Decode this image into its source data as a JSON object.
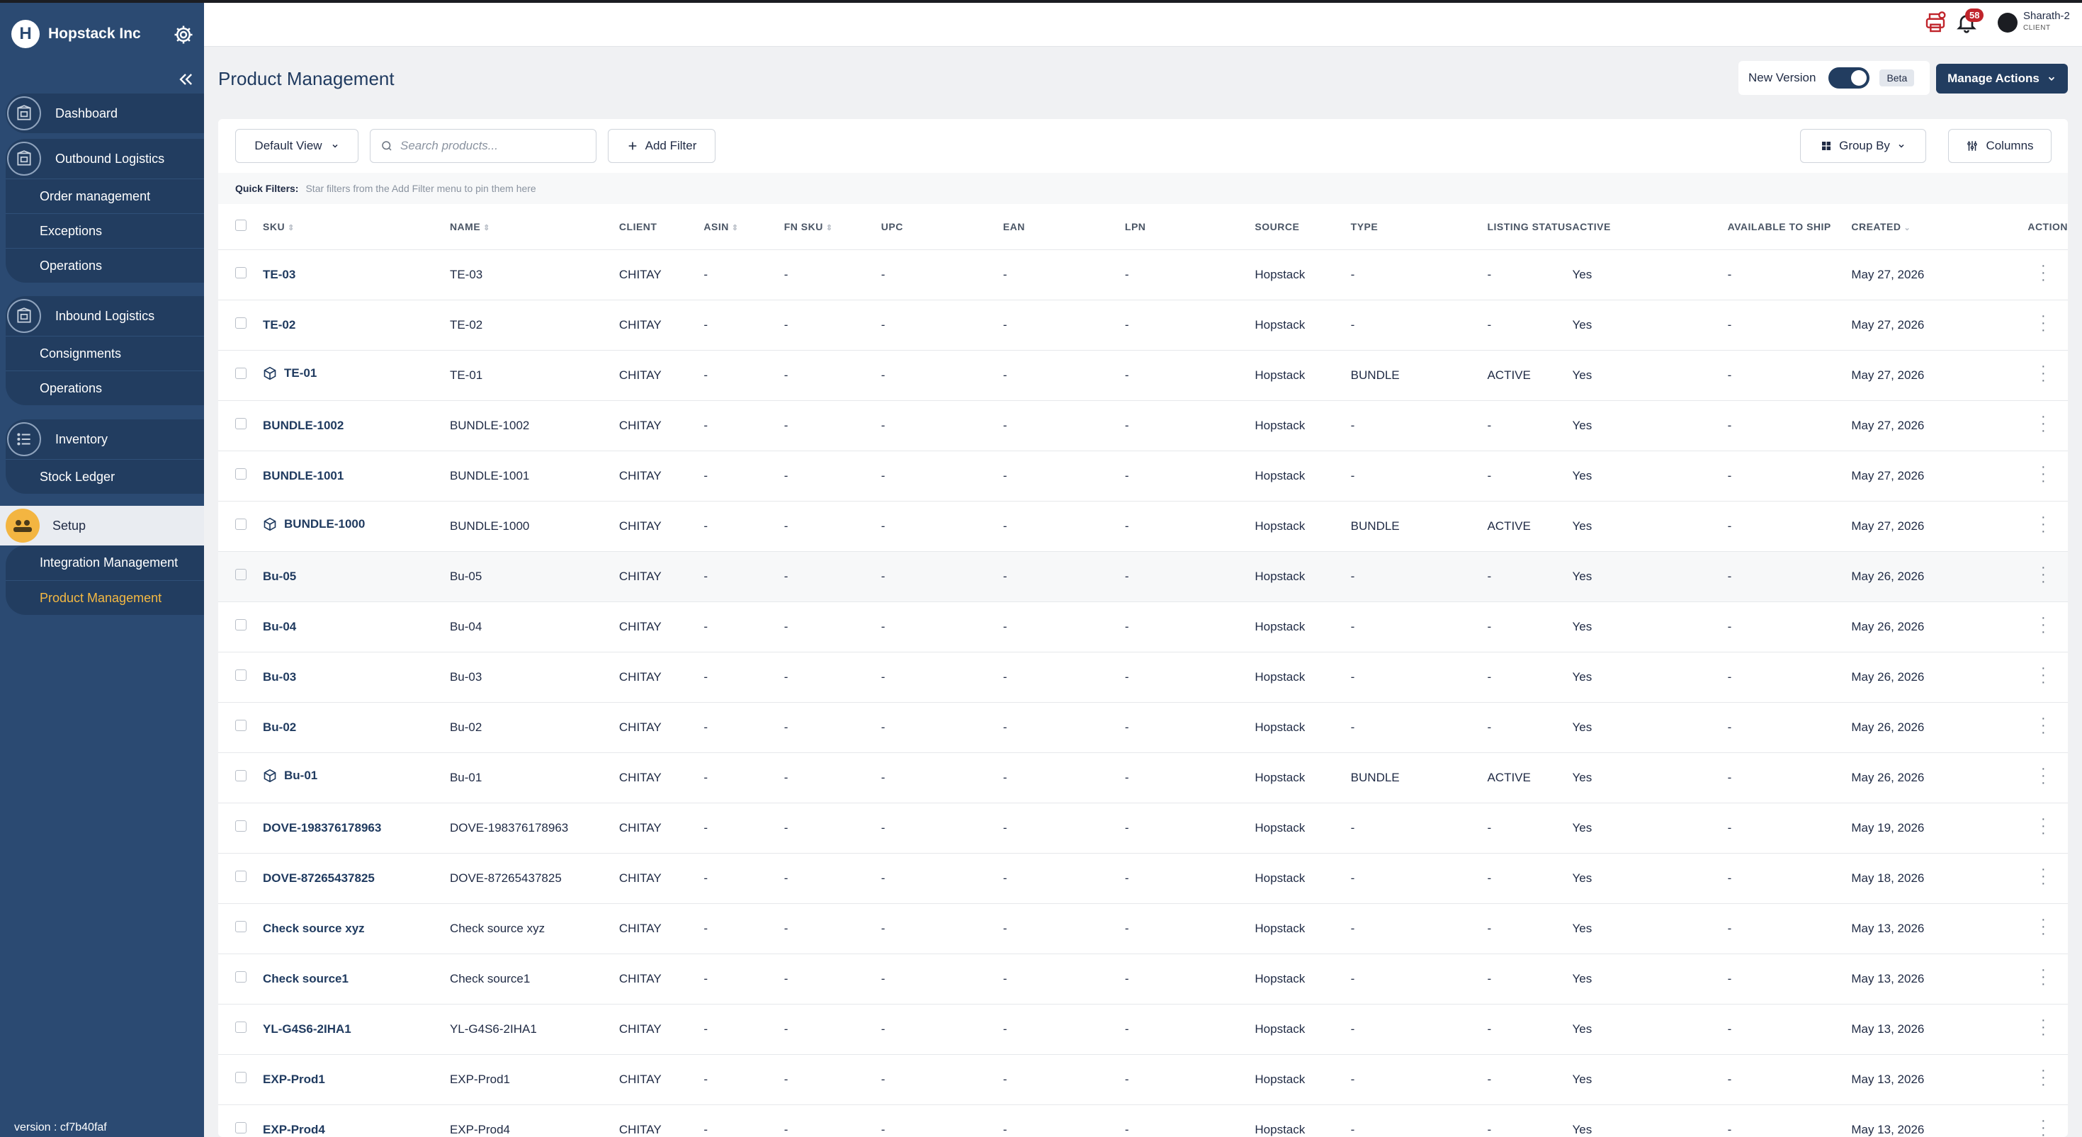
{
  "brand": {
    "name": "Hopstack Inc",
    "logo_letter": "H"
  },
  "sidebar": {
    "groups": [
      {
        "label": "Dashboard",
        "items": []
      },
      {
        "label": "Outbound Logistics",
        "items": [
          "Order management",
          "Exceptions",
          "Operations"
        ]
      },
      {
        "label": "Inbound Logistics",
        "items": [
          "Consignments",
          "Operations"
        ]
      },
      {
        "label": "Inventory",
        "items": [
          "Stock Ledger"
        ]
      },
      {
        "label": "Setup",
        "items": [
          "Integration Management",
          "Product Management"
        ]
      }
    ],
    "active_item": "Product Management",
    "version": "version : cf7b40faf"
  },
  "header": {
    "notification_count": "58",
    "user_name": "Sharath-2",
    "user_role": "CLIENT"
  },
  "page": {
    "title": "Product Management",
    "new_version_label": "New Version",
    "beta_label": "Beta",
    "manage_actions_label": "Manage Actions"
  },
  "toolbar": {
    "view_label": "Default View",
    "search_placeholder": "Search products...",
    "add_filter_label": "Add Filter",
    "group_by_label": "Group By",
    "columns_label": "Columns"
  },
  "quick_filters": {
    "label": "Quick Filters:",
    "hint": "Star filters from the Add Filter menu to pin them here"
  },
  "table": {
    "columns": [
      "SKU",
      "NAME",
      "CLIENT",
      "ASIN",
      "FN SKU",
      "UPC",
      "EAN",
      "LPN",
      "SOURCE",
      "TYPE",
      "LISTING STATUS",
      "ACTIVE",
      "AVAILABLE TO SHIP",
      "CREATED",
      "ACTION"
    ],
    "rows": [
      {
        "sku": "TE-03",
        "name": "TE-03",
        "client": "CHITAY",
        "asin": "-",
        "fnsku": "-",
        "upc": "-",
        "ean": "-",
        "lpn": "-",
        "source": "Hopstack",
        "type": "-",
        "listing": "-",
        "active": "Yes",
        "ats": "-",
        "created": "May 27, 2026",
        "bundle": false
      },
      {
        "sku": "TE-02",
        "name": "TE-02",
        "client": "CHITAY",
        "asin": "-",
        "fnsku": "-",
        "upc": "-",
        "ean": "-",
        "lpn": "-",
        "source": "Hopstack",
        "type": "-",
        "listing": "-",
        "active": "Yes",
        "ats": "-",
        "created": "May 27, 2026",
        "bundle": false
      },
      {
        "sku": "TE-01",
        "name": "TE-01",
        "client": "CHITAY",
        "asin": "-",
        "fnsku": "-",
        "upc": "-",
        "ean": "-",
        "lpn": "-",
        "source": "Hopstack",
        "type": "BUNDLE",
        "listing": "ACTIVE",
        "active": "Yes",
        "ats": "-",
        "created": "May 27, 2026",
        "bundle": true
      },
      {
        "sku": "BUNDLE-1002",
        "name": "BUNDLE-1002",
        "client": "CHITAY",
        "asin": "-",
        "fnsku": "-",
        "upc": "-",
        "ean": "-",
        "lpn": "-",
        "source": "Hopstack",
        "type": "-",
        "listing": "-",
        "active": "Yes",
        "ats": "-",
        "created": "May 27, 2026",
        "bundle": false
      },
      {
        "sku": "BUNDLE-1001",
        "name": "BUNDLE-1001",
        "client": "CHITAY",
        "asin": "-",
        "fnsku": "-",
        "upc": "-",
        "ean": "-",
        "lpn": "-",
        "source": "Hopstack",
        "type": "-",
        "listing": "-",
        "active": "Yes",
        "ats": "-",
        "created": "May 27, 2026",
        "bundle": false
      },
      {
        "sku": "BUNDLE-1000",
        "name": "BUNDLE-1000",
        "client": "CHITAY",
        "asin": "-",
        "fnsku": "-",
        "upc": "-",
        "ean": "-",
        "lpn": "-",
        "source": "Hopstack",
        "type": "BUNDLE",
        "listing": "ACTIVE",
        "active": "Yes",
        "ats": "-",
        "created": "May 27, 2026",
        "bundle": true
      },
      {
        "sku": "Bu-05",
        "name": "Bu-05",
        "client": "CHITAY",
        "asin": "-",
        "fnsku": "-",
        "upc": "-",
        "ean": "-",
        "lpn": "-",
        "source": "Hopstack",
        "type": "-",
        "listing": "-",
        "active": "Yes",
        "ats": "-",
        "created": "May 26, 2026",
        "bundle": false
      },
      {
        "sku": "Bu-04",
        "name": "Bu-04",
        "client": "CHITAY",
        "asin": "-",
        "fnsku": "-",
        "upc": "-",
        "ean": "-",
        "lpn": "-",
        "source": "Hopstack",
        "type": "-",
        "listing": "-",
        "active": "Yes",
        "ats": "-",
        "created": "May 26, 2026",
        "bundle": false
      },
      {
        "sku": "Bu-03",
        "name": "Bu-03",
        "client": "CHITAY",
        "asin": "-",
        "fnsku": "-",
        "upc": "-",
        "ean": "-",
        "lpn": "-",
        "source": "Hopstack",
        "type": "-",
        "listing": "-",
        "active": "Yes",
        "ats": "-",
        "created": "May 26, 2026",
        "bundle": false
      },
      {
        "sku": "Bu-02",
        "name": "Bu-02",
        "client": "CHITAY",
        "asin": "-",
        "fnsku": "-",
        "upc": "-",
        "ean": "-",
        "lpn": "-",
        "source": "Hopstack",
        "type": "-",
        "listing": "-",
        "active": "Yes",
        "ats": "-",
        "created": "May 26, 2026",
        "bundle": false
      },
      {
        "sku": "Bu-01",
        "name": "Bu-01",
        "client": "CHITAY",
        "asin": "-",
        "fnsku": "-",
        "upc": "-",
        "ean": "-",
        "lpn": "-",
        "source": "Hopstack",
        "type": "BUNDLE",
        "listing": "ACTIVE",
        "active": "Yes",
        "ats": "-",
        "created": "May 26, 2026",
        "bundle": true
      },
      {
        "sku": "DOVE-198376178963",
        "name": "DOVE-198376178963",
        "client": "CHITAY",
        "asin": "-",
        "fnsku": "-",
        "upc": "-",
        "ean": "-",
        "lpn": "-",
        "source": "Hopstack",
        "type": "-",
        "listing": "-",
        "active": "Yes",
        "ats": "-",
        "created": "May 19, 2026",
        "bundle": false
      },
      {
        "sku": "DOVE-87265437825",
        "name": "DOVE-87265437825",
        "client": "CHITAY",
        "asin": "-",
        "fnsku": "-",
        "upc": "-",
        "ean": "-",
        "lpn": "-",
        "source": "Hopstack",
        "type": "-",
        "listing": "-",
        "active": "Yes",
        "ats": "-",
        "created": "May 18, 2026",
        "bundle": false
      },
      {
        "sku": "Check source xyz",
        "name": "Check source xyz",
        "client": "CHITAY",
        "asin": "-",
        "fnsku": "-",
        "upc": "-",
        "ean": "-",
        "lpn": "-",
        "source": "Hopstack",
        "type": "-",
        "listing": "-",
        "active": "Yes",
        "ats": "-",
        "created": "May 13, 2026",
        "bundle": false
      },
      {
        "sku": "Check source1",
        "name": "Check source1",
        "client": "CHITAY",
        "asin": "-",
        "fnsku": "-",
        "upc": "-",
        "ean": "-",
        "lpn": "-",
        "source": "Hopstack",
        "type": "-",
        "listing": "-",
        "active": "Yes",
        "ats": "-",
        "created": "May 13, 2026",
        "bundle": false
      },
      {
        "sku": "YL-G4S6-2IHA1",
        "name": "YL-G4S6-2IHA1",
        "client": "CHITAY",
        "asin": "-",
        "fnsku": "-",
        "upc": "-",
        "ean": "-",
        "lpn": "-",
        "source": "Hopstack",
        "type": "-",
        "listing": "-",
        "active": "Yes",
        "ats": "-",
        "created": "May 13, 2026",
        "bundle": false
      },
      {
        "sku": "EXP-Prod1",
        "name": "EXP-Prod1",
        "client": "CHITAY",
        "asin": "-",
        "fnsku": "-",
        "upc": "-",
        "ean": "-",
        "lpn": "-",
        "source": "Hopstack",
        "type": "-",
        "listing": "-",
        "active": "Yes",
        "ats": "-",
        "created": "May 13, 2026",
        "bundle": false
      },
      {
        "sku": "EXP-Prod4",
        "name": "EXP-Prod4",
        "client": "CHITAY",
        "asin": "-",
        "fnsku": "-",
        "upc": "-",
        "ean": "-",
        "lpn": "-",
        "source": "Hopstack",
        "type": "-",
        "listing": "-",
        "active": "Yes",
        "ats": "-",
        "created": "May 13, 2026",
        "bundle": false
      }
    ]
  }
}
